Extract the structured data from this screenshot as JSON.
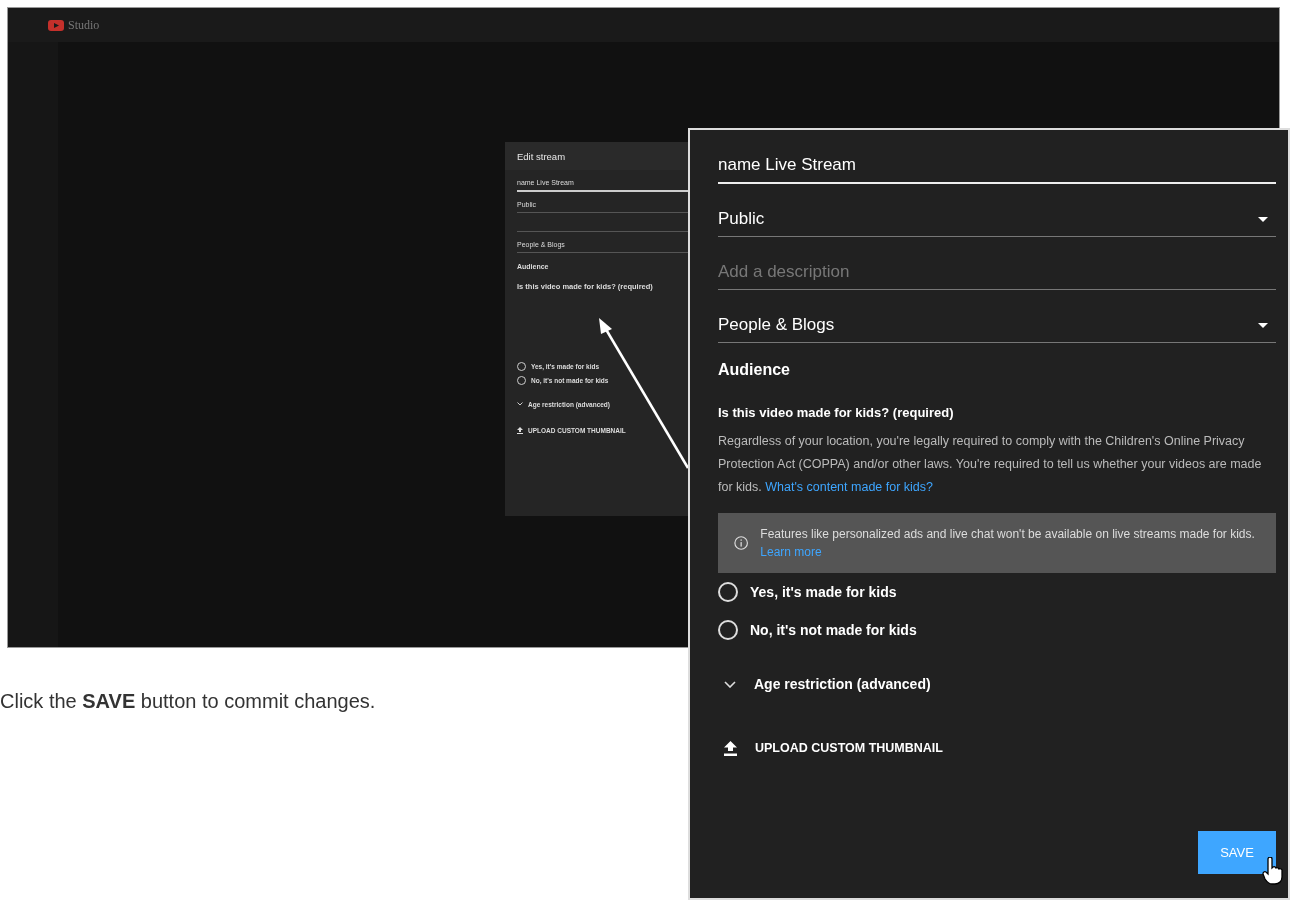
{
  "screenshot": {
    "logo": "Studio",
    "edit_stream": {
      "title": "Edit stream",
      "title_value": "name Live Stream",
      "visibility": "Public",
      "category": "People & Blogs",
      "audience_heading": "Audience",
      "question": "Is this video made for kids? (required)",
      "options": [
        {
          "label": "Yes, it's made for kids",
          "selected": false
        },
        {
          "label": "No, it's not made for kids",
          "selected": false
        }
      ],
      "age_restriction": "Age restriction (advanced)",
      "upload": "UPLOAD CUSTOM THUMBNAIL"
    }
  },
  "zoom_panel": {
    "title_value": "name Live Stream",
    "visibility": "Public",
    "description_placeholder": "Add a description",
    "category": "People & Blogs",
    "audience_heading": "Audience",
    "question": "Is this video made for kids? (required)",
    "body": "Regardless of your location, you're legally required to comply with the Children's Online Privacy Protection Act (COPPA) and/or other laws. You're required to tell us whether your videos are made for kids.",
    "body_link": "What's content made for kids?",
    "notice": "Features like personalized ads and live chat won't be available on live streams made for kids.",
    "notice_link": "Learn more",
    "options": [
      {
        "label": "Yes, it's made for kids",
        "selected": false
      },
      {
        "label": "No, it's not made for kids",
        "selected": false
      }
    ],
    "age_restriction": "Age restriction (advanced)",
    "upload": "UPLOAD CUSTOM THUMBNAIL",
    "save_button": "SAVE"
  },
  "caption": "Click the **SAVE** button to commit changes."
}
